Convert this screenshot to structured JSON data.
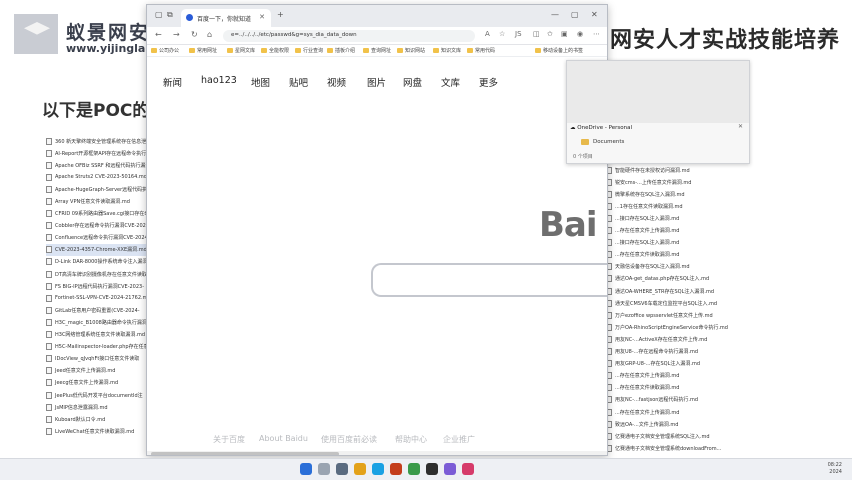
{
  "slide": {
    "logo_title": "蚁景网安",
    "logo_sub": "www.yijinglab.com",
    "headline": "网安人才实战技能培养",
    "subtitle": "以下是POC的一"
  },
  "poc_left": [
    "360 新天擎终端安全管理系统存在信息泄露",
    "AI-Report开源框架API存在远程命令执行",
    "Apache OFBiz SSRF 和远程代码执行漏洞",
    "Apache Struts2 CVE-2023-50164.md",
    "Apache-HugeGraph-Server远程代码执行",
    "Array VPN任意文件读取漏洞.md",
    "CFRID 09系列路由器Save.cgi接口存在命令",
    "Cobbler存在远程命令执行漏洞CVE-2024-",
    "Confluence远程命令执行漏洞CVE-2024-",
    "CVE-2023-4357-Chrome-XXE漏洞.md",
    "D-Link DAR-8000操作系统命令注入漏洞",
    "DT高清车牌识别摄像机存在任意文件读取",
    "FS BIG-IP远程代码执行漏洞CVE-2023-",
    "Fortinet-SSL-VPN-CVE-2024-21762.md",
    "GitLab任意用户密码重置(CVE-2024-",
    "H3C_magic_B1008路由器命令执行漏洞",
    "H3C网络管理系统任意文件读取漏洞.md",
    "H5C-Mailinspector-loader.php存在任意",
    "IDocView_qJvqhFt接口任意文件读取",
    "Jeed任意文件上传漏洞.md",
    "Jeecg任意文件上传漏洞.md",
    "JeePlus低代码开发平台documentId注",
    "JsMIP信息泄露漏洞.md",
    "Kuboard默认口令.md",
    "LiveWeChat任意文件读取漏洞.md"
  ],
  "poc_right": [
    "...已存在文件任意读取漏洞.md",
    "智能硬件存在未授权访问漏洞.md",
    "锐安cms-...上传任意文件漏洞.md",
    "微擎系统存在SQL注入漏洞.md",
    "...1存在任意文件读取漏洞.md",
    "...接口存在SQL注入漏洞.md",
    "...存在任意文件上传漏洞.md",
    "...接口存在SQL注入漏洞.md",
    "...存在任意文件读取漏洞.md",
    "天融信设备存在SQL注入漏洞.md",
    "通达OA-get_datas.php存在SQL注入.md",
    "通达OA-WHERE_STR存在SQL注入漏洞.md",
    "通天星CMSV6车载定位监控平台SQL注入.md",
    "万户ezoffice wpsservlet任意文件上传.md",
    "万户OA-RhinoScriptEngineService命令执行.md",
    "用友NC-...ActiveX存在任意文件上传.md",
    "用友U8-...存在远程命令执行漏洞.md",
    "用友GRP-U8-...存在SQL注入漏洞.md",
    "...存在任意文件上传漏洞.md",
    "...存在任意文件读取漏洞.md",
    "用友NC-...fastjson远程代码执行.md",
    "...存在任意文件上传漏洞.md",
    "致远OA-...文件上传漏洞.md",
    "亿赛通电子文档安全管理系统SQL注入.md",
    "亿赛通电子文档安全管理系统downloadFrom..."
  ],
  "poc_mid": [
    "...d",
    "...md",
    "...md",
    "...md",
    "...md",
    "...md",
    "...md",
    "...md",
    "...md",
    "...md",
    "...md",
    "...md",
    "...md",
    "...md",
    "...md",
    "...md",
    "...md",
    "...md",
    "...md",
    "...md",
    "...md",
    "...md",
    "...md",
    "...md"
  ],
  "browser": {
    "tab_title": "百度一下，你就知道",
    "address": "e=../../../../etc/passwd&g=sys_dia_data_down",
    "bookmarks": [
      "公司办公",
      "常用网址",
      "星网文库",
      "全能权限",
      "行业查询",
      "插板介绍",
      "查询网址",
      "知识网站",
      "知识文库",
      "常用代码"
    ],
    "bookmark_right": "移动设备上的书签",
    "baidu_nav": [
      "新闻",
      "hao123",
      "地图",
      "贴吧",
      "视频",
      "图片",
      "网盘",
      "文库",
      "更多"
    ],
    "baidu_logo": "Bai",
    "footer": [
      "关于百度",
      "About Baidu",
      "使用百度前必读",
      "帮助中心",
      "企业推广"
    ]
  },
  "onedrive": {
    "tab": "OneDrive - Personal",
    "folder": "Documents",
    "count": "0 个项目"
  },
  "taskbar": {
    "time": "08:22",
    "date": "2024"
  }
}
